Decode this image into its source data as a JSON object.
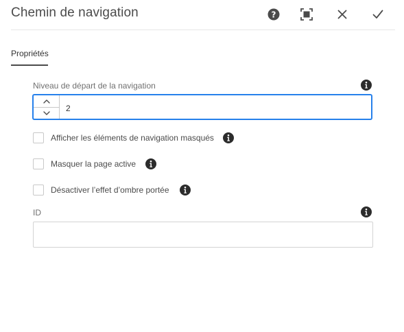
{
  "dialog": {
    "title": "Chemin de navigation",
    "help_icon": "help-icon",
    "fullscreen_icon": "fullscreen-icon",
    "close_icon": "close-icon",
    "confirm_icon": "check-icon"
  },
  "tabs": [
    {
      "label": "Propriétés",
      "selected": true
    }
  ],
  "form": {
    "start_level": {
      "label": "Niveau de départ de la navigation",
      "value": "2"
    },
    "checkboxes": [
      {
        "label": "Afficher les éléments de navigation masqués",
        "checked": false
      },
      {
        "label": "Masquer la page active",
        "checked": false
      },
      {
        "label": "Désactiver l’effet d’ombre portée",
        "checked": false
      }
    ],
    "id_field": {
      "label": "ID",
      "value": ""
    }
  },
  "colors": {
    "focus_border": "#2680eb",
    "icon": "#4b4b4b",
    "info_icon": "#2c2c2c"
  }
}
